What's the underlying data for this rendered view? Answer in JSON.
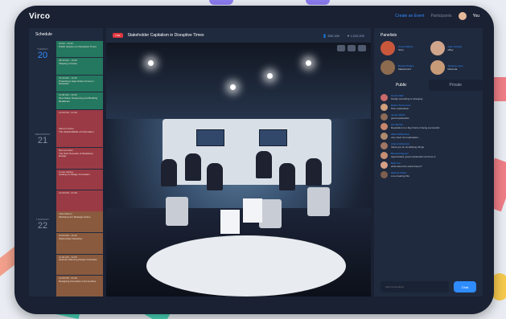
{
  "app": {
    "logo": "Virco",
    "create_label": "Create an Event",
    "participants_label": "Participants",
    "user_name": "You"
  },
  "schedule": {
    "title": "Schedule",
    "days": [
      {
        "weekday": "TUESDAY",
        "day": "20",
        "active": true,
        "events": [
          {
            "time": "10:00 - 10:30",
            "title": "Public Session on Disruptive Times",
            "color": "g"
          },
          {
            "time": "08:30 AM - 10:00",
            "title": "Shaping a Future",
            "color": "g"
          },
          {
            "time": "10:30 AM - 11:00",
            "title": "Protecting Large-Scale Common Networks",
            "color": "g"
          },
          {
            "time": "11:00 AM - 12:00",
            "title": "New Rules: Deepening and Building Resilience",
            "color": "g"
          },
          {
            "time": "12:00 PM - 01:00",
            "title": "",
            "color": "r"
          }
        ]
      },
      {
        "weekday": "WEDNESDAY",
        "day": "21",
        "active": false,
        "events": [
          {
            "time": "Marcus Fisher",
            "title": "The Global Middle of Information",
            "color": "r"
          },
          {
            "time": "Bernard Allen",
            "title": "The Tech Scenario of Workshop Design",
            "color": "r"
          },
          {
            "time": "Lucas Hartley",
            "title": "Getting on Design Innovation",
            "color": "r"
          },
          {
            "time": "12:00 PM - 01:00",
            "title": "",
            "color": "r"
          }
        ]
      },
      {
        "weekday": "THURSDAY",
        "day": "22",
        "active": false,
        "events": [
          {
            "time": "Julia Warren",
            "title": "Workshop for Strategic Action",
            "color": "b"
          },
          {
            "time": "10:00 AM - 11:00",
            "title": "Partnership Industries",
            "color": "b"
          },
          {
            "time": "11:00 AM - 12:00",
            "title": "Network Planning Design Industries",
            "color": "b"
          },
          {
            "time": "12:00 PM - 01:00",
            "title": "Designing Innovative Communities",
            "color": "b"
          }
        ]
      }
    ]
  },
  "video": {
    "live_label": "LIVE",
    "title": "Stakeholder Capitalism in Disruptive Times",
    "viewers": "355,158",
    "likes": "1,520,000"
  },
  "panelists": {
    "title": "Panelists",
    "items": [
      {
        "name": "Tonya Malone",
        "company": "Sony",
        "color": "#c9573c"
      },
      {
        "name": "Juan Howard",
        "company": "eBay",
        "color": "#d0a58c"
      },
      {
        "name": "Brooks Phelps",
        "company": "MasterCard",
        "color": "#8d6b4f"
      },
      {
        "name": "Terrance Lane",
        "company": "Motorola",
        "color": "#c89b78"
      }
    ]
  },
  "tabs": {
    "public": "Public",
    "private": "Private"
  },
  "chat": {
    "messages": [
      {
        "name": "Connie Bell",
        "text": "Finally something is changing",
        "color": "#c96a6a"
      },
      {
        "name": "Esther Simmmons",
        "text": "Nice explanation.",
        "color": "#d1a07c"
      },
      {
        "name": "Jennie Webb",
        "text": "good explanation",
        "color": "#8c6b58"
      },
      {
        "name": "Lily Warren",
        "text": "Reputation is a big chunk of being successful",
        "color": "#c8866c"
      },
      {
        "name": "Albert Williamson",
        "text": "very clear cut explanation...",
        "color": "#b08a6e"
      },
      {
        "name": "Arlene Robertson",
        "text": "thank you for simplifying things",
        "color": "#9f7663"
      },
      {
        "name": "Bernard Nguyen",
        "text": "Appreciated, great explanation and love it.",
        "color": "#c58f74"
      },
      {
        "name": "Beth Fox",
        "text": "what about the stock theory?",
        "color": "#d89f85"
      },
      {
        "name": "Mitchell Fisher",
        "text": "Love hearing this",
        "color": "#7d5f4f"
      }
    ],
    "input_placeholder": "Add conversation",
    "send_label": "Chat"
  }
}
